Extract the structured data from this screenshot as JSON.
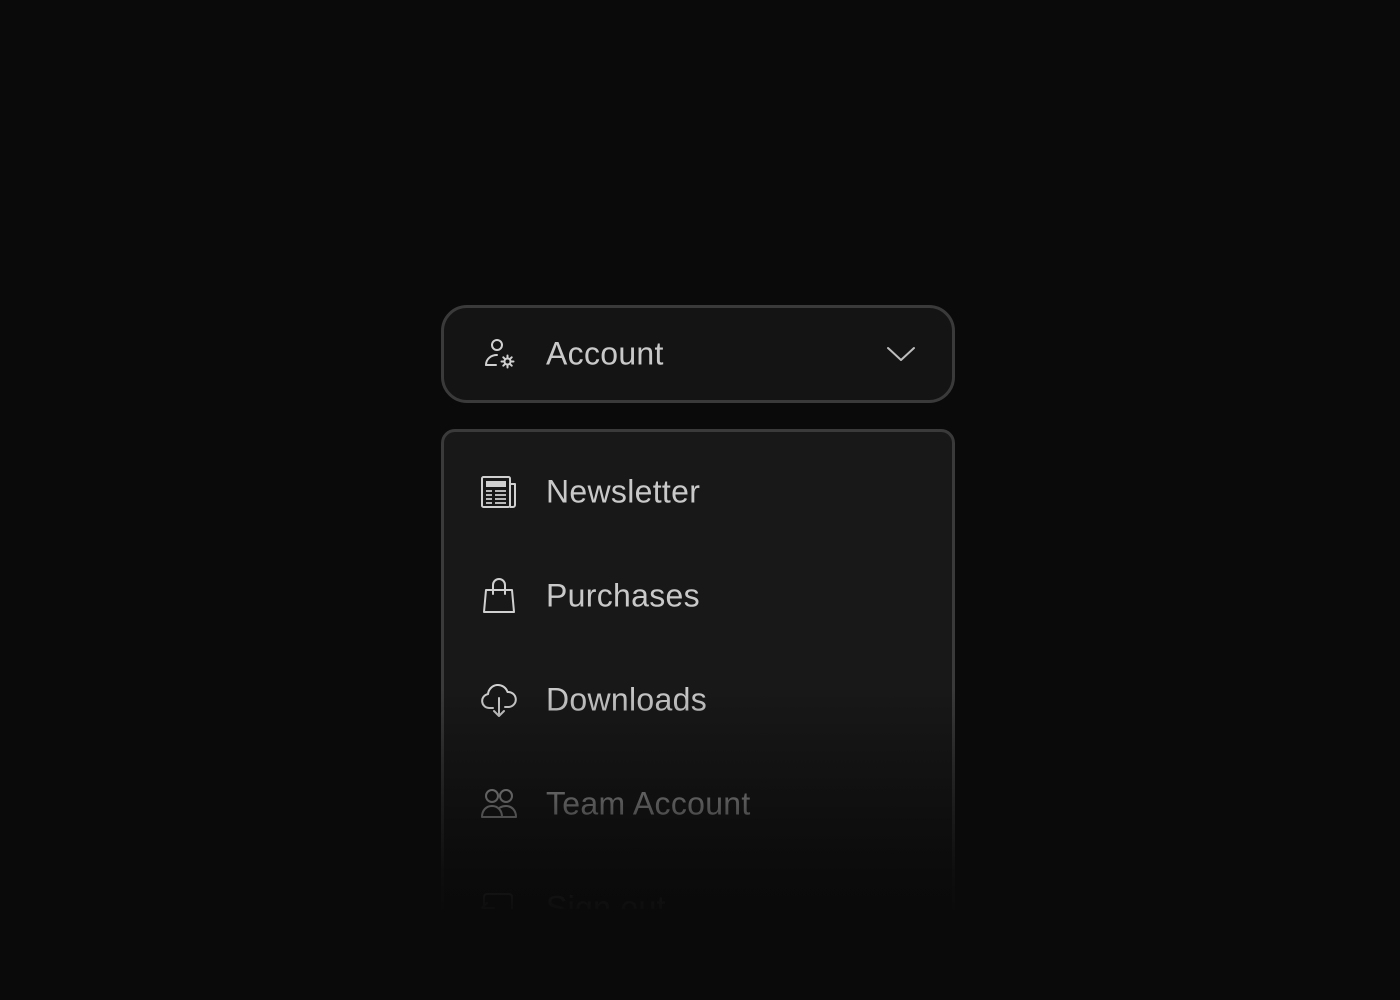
{
  "dropdown": {
    "selected_label": "Account",
    "selected_icon": "user-settings-icon",
    "expanded": true
  },
  "menu": {
    "items": [
      {
        "label": "Newsletter",
        "icon": "newspaper-icon"
      },
      {
        "label": "Purchases",
        "icon": "shopping-bag-icon"
      },
      {
        "label": "Downloads",
        "icon": "cloud-download-icon"
      },
      {
        "label": "Team Account",
        "icon": "users-icon"
      },
      {
        "label": "Sign out",
        "icon": "sign-out-icon"
      }
    ]
  },
  "colors": {
    "background": "#0a0a0a",
    "surface": "#181818",
    "border": "#3a3a3a",
    "text": "#c9c9c9"
  }
}
